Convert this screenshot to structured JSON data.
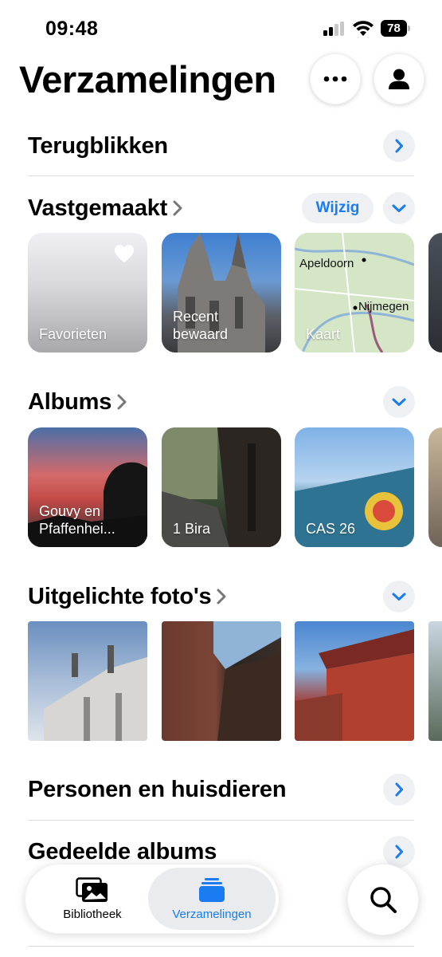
{
  "status_bar": {
    "time": "09:48",
    "battery": "78"
  },
  "header": {
    "title": "Verzamelingen"
  },
  "sections": {
    "recaps": {
      "title": "Terugblikken"
    },
    "pinned": {
      "title": "Vastgemaakt",
      "edit_label": "Wijzig",
      "items": [
        {
          "label": "Favorieten"
        },
        {
          "label": "Recent bewaard"
        },
        {
          "label": "Kaart",
          "map_labels": [
            "Apeldoorn",
            "Nijmegen"
          ]
        }
      ]
    },
    "albums": {
      "title": "Albums",
      "items": [
        {
          "label": "Gouvy en Pfaffenhei..."
        },
        {
          "label": "1 Bira"
        },
        {
          "label": "CAS 26"
        }
      ]
    },
    "featured": {
      "title": "Uitgelichte foto's"
    },
    "people": {
      "title": "Personen en huisdieren"
    },
    "shared": {
      "title": "Gedeelde albums"
    }
  },
  "tabbar": {
    "library_label": "Bibliotheek",
    "collections_label": "Verzamelingen"
  },
  "colors": {
    "accent": "#1a7cf0",
    "chip_bg": "#eef0f4"
  },
  "icons": [
    "ellipsis-icon",
    "person-icon",
    "chevron-right-icon",
    "chevron-down-icon",
    "heart-icon",
    "photos-library-icon",
    "collections-icon",
    "search-icon"
  ]
}
